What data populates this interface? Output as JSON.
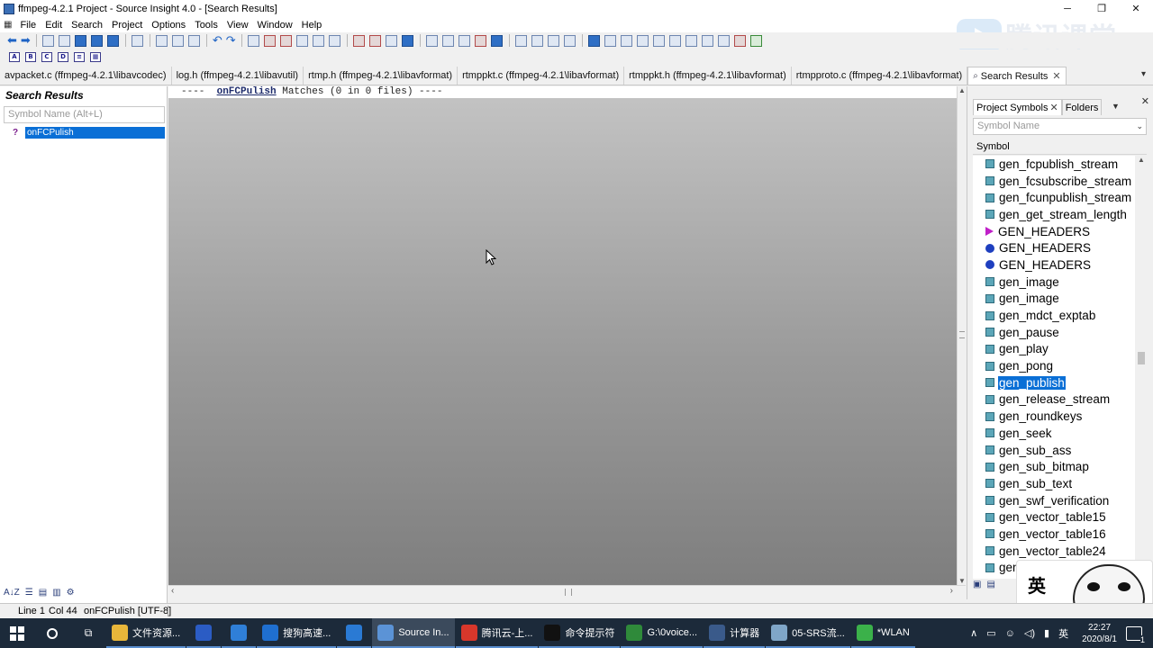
{
  "window": {
    "title": "ffmpeg-4.2.1 Project - Source Insight 4.0 - [Search Results]",
    "minimize": "─",
    "maximize": "❐",
    "close": "✕"
  },
  "logo": {
    "text": "腾讯课堂"
  },
  "menu": {
    "items": [
      "File",
      "Edit",
      "Search",
      "Project",
      "Options",
      "Tools",
      "View",
      "Window",
      "Help"
    ]
  },
  "tabs": [
    {
      "label": "avpacket.c (ffmpeg-4.2.1\\libavcodec)"
    },
    {
      "label": "log.h (ffmpeg-4.2.1\\libavutil)"
    },
    {
      "label": "rtmp.h (ffmpeg-4.2.1\\libavformat)"
    },
    {
      "label": "rtmppkt.c (ffmpeg-4.2.1\\libavformat)"
    },
    {
      "label": "rtmppkt.h (ffmpeg-4.2.1\\libavformat)"
    },
    {
      "label": "rtmpproto.c (ffmpeg-4.2.1\\libavformat)"
    },
    {
      "label": "Search Results",
      "active": true
    }
  ],
  "search_panel": {
    "title": "Search Results",
    "placeholder": "Symbol Name (Alt+L)",
    "result": "onFCPulish"
  },
  "editor": {
    "prefix": "----  ",
    "keyword": "onFCPulish",
    "suffix": " Matches (0 in 0 files) ----"
  },
  "symbols_panel": {
    "tab_project_symbols": "Project Symbols",
    "tab_folders": "Folders",
    "placeholder": "Symbol Name",
    "header": "Symbol",
    "items": [
      {
        "label": "gen_fcpublish_stream",
        "kind": "func"
      },
      {
        "label": "gen_fcsubscribe_stream",
        "kind": "func"
      },
      {
        "label": "gen_fcunpublish_stream",
        "kind": "func"
      },
      {
        "label": "gen_get_stream_length",
        "kind": "func"
      },
      {
        "label": "GEN_HEADERS",
        "kind": "macro"
      },
      {
        "label": "GEN_HEADERS",
        "kind": "var"
      },
      {
        "label": "GEN_HEADERS",
        "kind": "var"
      },
      {
        "label": "gen_image",
        "kind": "func"
      },
      {
        "label": "gen_image",
        "kind": "func"
      },
      {
        "label": "gen_mdct_exptab",
        "kind": "func"
      },
      {
        "label": "gen_pause",
        "kind": "func"
      },
      {
        "label": "gen_play",
        "kind": "func"
      },
      {
        "label": "gen_pong",
        "kind": "func"
      },
      {
        "label": "gen_publish",
        "kind": "func",
        "selected": true
      },
      {
        "label": "gen_release_stream",
        "kind": "func"
      },
      {
        "label": "gen_roundkeys",
        "kind": "func"
      },
      {
        "label": "gen_seek",
        "kind": "func"
      },
      {
        "label": "gen_sub_ass",
        "kind": "func"
      },
      {
        "label": "gen_sub_bitmap",
        "kind": "func"
      },
      {
        "label": "gen_sub_text",
        "kind": "func"
      },
      {
        "label": "gen_swf_verification",
        "kind": "func"
      },
      {
        "label": "gen_vector_table15",
        "kind": "func"
      },
      {
        "label": "gen_vector_table16",
        "kind": "func"
      },
      {
        "label": "gen_vector_table24",
        "kind": "func"
      },
      {
        "label": "gen",
        "kind": "func"
      }
    ]
  },
  "sticker": {
    "ime_char": "英"
  },
  "status": {
    "line": "Line 1",
    "col": "Col 44",
    "symbol": "onFCPulish [UTF-8]"
  },
  "taskbar": {
    "apps": [
      {
        "label": "文件资源...",
        "color": "#e8b63a"
      },
      {
        "label": "",
        "color": "#2b5cc4"
      },
      {
        "label": "",
        "color": "#2f7fd8"
      },
      {
        "label": "搜狗高速...",
        "color": "#1f6fd0"
      },
      {
        "label": "",
        "color": "#2a7ad4"
      },
      {
        "label": "Source In...",
        "color": "#5b93d6",
        "active": true
      },
      {
        "label": "腾讯云-上...",
        "color": "#d8372b"
      },
      {
        "label": "命令提示符",
        "color": "#111111"
      },
      {
        "label": "G:\\0voice...",
        "color": "#2f8a3a"
      },
      {
        "label": "计算器",
        "color": "#3a5a8a"
      },
      {
        "label": "05-SRS流...",
        "color": "#7fa6c8"
      },
      {
        "label": "*WLAN",
        "color": "#3bb14a"
      }
    ],
    "time": "22:27",
    "date": "2020/8/1",
    "notify_count": "1"
  },
  "colors": {
    "selection": "#0a6fd6",
    "taskbar": "#1c2a3a"
  }
}
